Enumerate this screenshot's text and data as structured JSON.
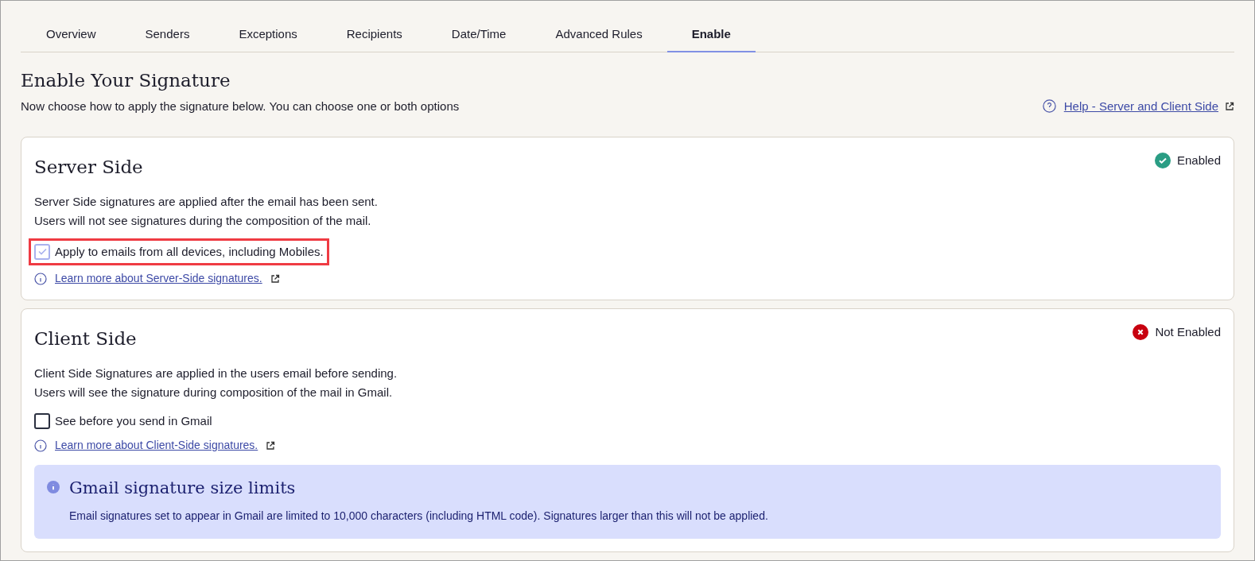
{
  "tabs": [
    {
      "label": "Overview",
      "selected": false
    },
    {
      "label": "Senders",
      "selected": false
    },
    {
      "label": "Exceptions",
      "selected": false
    },
    {
      "label": "Recipients",
      "selected": false
    },
    {
      "label": "Date/Time",
      "selected": false
    },
    {
      "label": "Advanced Rules",
      "selected": false
    },
    {
      "label": "Enable",
      "selected": true
    }
  ],
  "header": {
    "title": "Enable Your Signature",
    "subtitle": "Now choose how to apply the signature below. You can choose one or both options",
    "help_link": "Help - Server and Client Side"
  },
  "sections": [
    {
      "title": "Server Side",
      "enabled": true,
      "status": "Enabled",
      "lines": [
        "Server Side signatures are applied after the email has been sent.",
        "Users will not see signatures during the composition of the mail."
      ],
      "checkbox": {
        "label": "Apply to emails from all devices, including Mobiles.",
        "checked": true,
        "highlighted": true
      },
      "link": "Learn more about Server-Side signatures."
    },
    {
      "title": "Client Side",
      "enabled": false,
      "status": "Not Enabled",
      "lines": [
        "Client Side Signatures are applied in the users email before sending.",
        "Users will see the signature during composition of the mail in Gmail."
      ],
      "checkbox": {
        "label": "See before you send in Gmail",
        "checked": false,
        "highlighted": false
      },
      "link": "Learn more about Client-Side signatures.",
      "notice": {
        "title": "Gmail signature size limits",
        "text": "Email signatures set to appear in Gmail are limited to 10,000 characters (including HTML code). Signatures larger than this will not be applied."
      }
    }
  ]
}
